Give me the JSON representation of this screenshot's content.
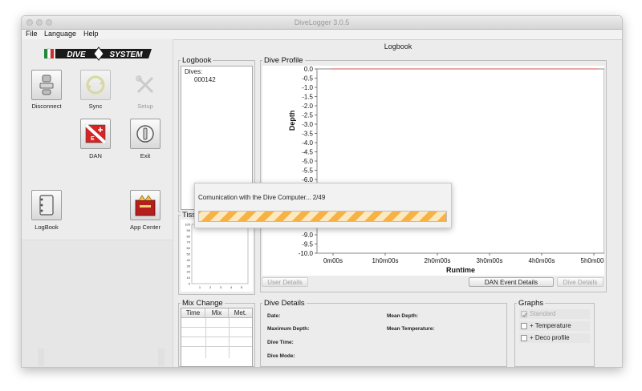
{
  "window": {
    "title": "DiveLogger 3.0.5"
  },
  "menu": [
    "File",
    "Language",
    "Help"
  ],
  "sidebar": {
    "logo_text": "DIVESYSTEM",
    "buttons": [
      {
        "label": "Disconnect",
        "icon": "connector-icon",
        "enabled": true
      },
      {
        "label": "Sync",
        "icon": "sync-icon",
        "enabled": false
      },
      {
        "label": "Setup",
        "icon": "tools-icon",
        "enabled": false
      },
      {
        "label": "DAN",
        "icon": "dan-flag-icon",
        "enabled": true
      },
      {
        "label": "Exit",
        "icon": "exit-icon",
        "enabled": true
      },
      {
        "label": "LogBook",
        "icon": "logbook-icon",
        "enabled": true
      },
      {
        "label": "App Center",
        "icon": "app-center-icon",
        "enabled": true
      }
    ]
  },
  "header": {
    "title": "Logbook"
  },
  "logbook": {
    "title": "Logbook",
    "dives_header": "Dives:",
    "dives": [
      "000142"
    ]
  },
  "tissue": {
    "title": "Tiss"
  },
  "dive_profile": {
    "title": "Dive Profile",
    "buttons": {
      "user_details": "User Details",
      "dan_event_details": "DAN Event Details",
      "dive_details": "Dive Details"
    }
  },
  "mix_change": {
    "title": "Mix Change",
    "columns": [
      "Time",
      "Mix",
      "Met."
    ]
  },
  "dive_details": {
    "title": "Dive Details",
    "labels": {
      "date": "Date:",
      "max_depth": "Maximum Depth:",
      "dive_time": "Dive Time:",
      "dive_mode": "Dive Mode:",
      "mean_depth": "Mean Depth:",
      "mean_temp": "Mean Temperature:"
    }
  },
  "graphs": {
    "title": "Graphs",
    "options": [
      {
        "label": "Standard",
        "checked": true,
        "enabled": false
      },
      {
        "label": "+ Temperature",
        "checked": false,
        "enabled": true
      },
      {
        "label": "+ Deco profile",
        "checked": false,
        "enabled": true
      }
    ]
  },
  "progress_dialog": {
    "message": "Comunication with the Dive Computer... 2/49",
    "progress": 0.041
  },
  "chart_data": {
    "type": "line",
    "xlabel": "Runtime",
    "ylabel": "Depth",
    "ylim": [
      -10.0,
      0.0
    ],
    "y_ticks": [
      "0.0",
      "-0.5",
      "-1.0",
      "-1.5",
      "-2.0",
      "-2.5",
      "-3.0",
      "-3.5",
      "-4.0",
      "-4.5",
      "-5.0",
      "-5.5",
      "-6.0",
      "-6.5",
      "-7.0",
      "-7.5",
      "-8.0",
      "-8.5",
      "-9.0",
      "-9.5",
      "-10.0"
    ],
    "x_ticks": [
      "0m00s",
      "1h0m00s",
      "2h0m00s",
      "3h0m00s",
      "4h0m00s",
      "5h0m00s"
    ],
    "series": [
      {
        "values": [
          0.0,
          0.0
        ],
        "color": "#d94c4c"
      }
    ],
    "grid": false
  },
  "tissue_chart": {
    "type": "bar",
    "y_ticks": [
      "100",
      "90",
      "80",
      "70",
      "60",
      "50",
      "40",
      "30",
      "20",
      "10",
      "0"
    ],
    "x_ticks": [
      "1",
      "2",
      "3",
      "4",
      "5"
    ],
    "ylim": [
      0,
      100
    ]
  },
  "colors": {
    "progress": "#f7b245",
    "series": "#d94c4c",
    "dan_red": "#d82323"
  }
}
